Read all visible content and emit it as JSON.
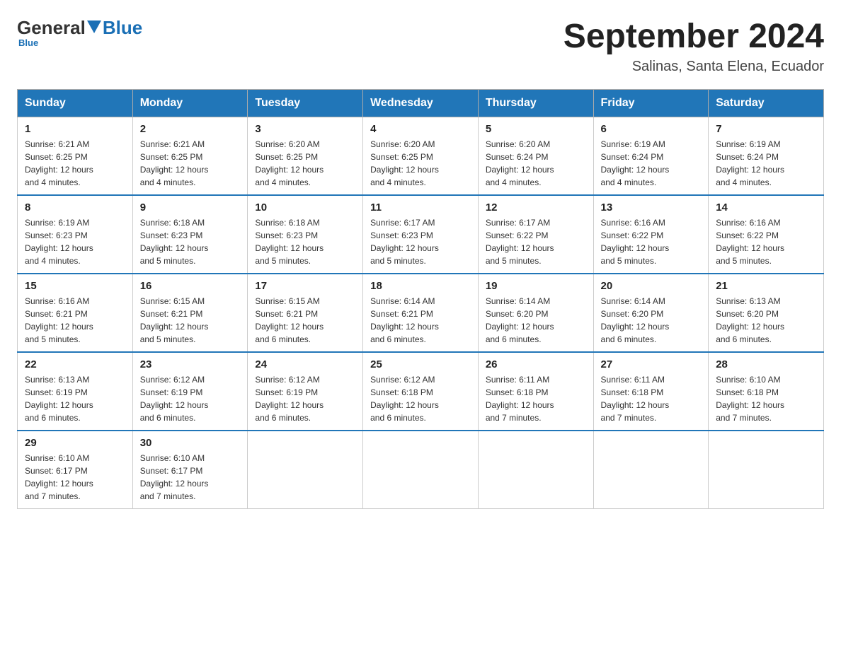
{
  "header": {
    "logo_general": "General",
    "logo_blue": "Blue",
    "month_title": "September 2024",
    "location": "Salinas, Santa Elena, Ecuador"
  },
  "days_of_week": [
    "Sunday",
    "Monday",
    "Tuesday",
    "Wednesday",
    "Thursday",
    "Friday",
    "Saturday"
  ],
  "weeks": [
    [
      {
        "day": "1",
        "sunrise": "6:21 AM",
        "sunset": "6:25 PM",
        "daylight": "12 hours and 4 minutes."
      },
      {
        "day": "2",
        "sunrise": "6:21 AM",
        "sunset": "6:25 PM",
        "daylight": "12 hours and 4 minutes."
      },
      {
        "day": "3",
        "sunrise": "6:20 AM",
        "sunset": "6:25 PM",
        "daylight": "12 hours and 4 minutes."
      },
      {
        "day": "4",
        "sunrise": "6:20 AM",
        "sunset": "6:25 PM",
        "daylight": "12 hours and 4 minutes."
      },
      {
        "day": "5",
        "sunrise": "6:20 AM",
        "sunset": "6:24 PM",
        "daylight": "12 hours and 4 minutes."
      },
      {
        "day": "6",
        "sunrise": "6:19 AM",
        "sunset": "6:24 PM",
        "daylight": "12 hours and 4 minutes."
      },
      {
        "day": "7",
        "sunrise": "6:19 AM",
        "sunset": "6:24 PM",
        "daylight": "12 hours and 4 minutes."
      }
    ],
    [
      {
        "day": "8",
        "sunrise": "6:19 AM",
        "sunset": "6:23 PM",
        "daylight": "12 hours and 4 minutes."
      },
      {
        "day": "9",
        "sunrise": "6:18 AM",
        "sunset": "6:23 PM",
        "daylight": "12 hours and 5 minutes."
      },
      {
        "day": "10",
        "sunrise": "6:18 AM",
        "sunset": "6:23 PM",
        "daylight": "12 hours and 5 minutes."
      },
      {
        "day": "11",
        "sunrise": "6:17 AM",
        "sunset": "6:23 PM",
        "daylight": "12 hours and 5 minutes."
      },
      {
        "day": "12",
        "sunrise": "6:17 AM",
        "sunset": "6:22 PM",
        "daylight": "12 hours and 5 minutes."
      },
      {
        "day": "13",
        "sunrise": "6:16 AM",
        "sunset": "6:22 PM",
        "daylight": "12 hours and 5 minutes."
      },
      {
        "day": "14",
        "sunrise": "6:16 AM",
        "sunset": "6:22 PM",
        "daylight": "12 hours and 5 minutes."
      }
    ],
    [
      {
        "day": "15",
        "sunrise": "6:16 AM",
        "sunset": "6:21 PM",
        "daylight": "12 hours and 5 minutes."
      },
      {
        "day": "16",
        "sunrise": "6:15 AM",
        "sunset": "6:21 PM",
        "daylight": "12 hours and 5 minutes."
      },
      {
        "day": "17",
        "sunrise": "6:15 AM",
        "sunset": "6:21 PM",
        "daylight": "12 hours and 6 minutes."
      },
      {
        "day": "18",
        "sunrise": "6:14 AM",
        "sunset": "6:21 PM",
        "daylight": "12 hours and 6 minutes."
      },
      {
        "day": "19",
        "sunrise": "6:14 AM",
        "sunset": "6:20 PM",
        "daylight": "12 hours and 6 minutes."
      },
      {
        "day": "20",
        "sunrise": "6:14 AM",
        "sunset": "6:20 PM",
        "daylight": "12 hours and 6 minutes."
      },
      {
        "day": "21",
        "sunrise": "6:13 AM",
        "sunset": "6:20 PM",
        "daylight": "12 hours and 6 minutes."
      }
    ],
    [
      {
        "day": "22",
        "sunrise": "6:13 AM",
        "sunset": "6:19 PM",
        "daylight": "12 hours and 6 minutes."
      },
      {
        "day": "23",
        "sunrise": "6:12 AM",
        "sunset": "6:19 PM",
        "daylight": "12 hours and 6 minutes."
      },
      {
        "day": "24",
        "sunrise": "6:12 AM",
        "sunset": "6:19 PM",
        "daylight": "12 hours and 6 minutes."
      },
      {
        "day": "25",
        "sunrise": "6:12 AM",
        "sunset": "6:18 PM",
        "daylight": "12 hours and 6 minutes."
      },
      {
        "day": "26",
        "sunrise": "6:11 AM",
        "sunset": "6:18 PM",
        "daylight": "12 hours and 7 minutes."
      },
      {
        "day": "27",
        "sunrise": "6:11 AM",
        "sunset": "6:18 PM",
        "daylight": "12 hours and 7 minutes."
      },
      {
        "day": "28",
        "sunrise": "6:10 AM",
        "sunset": "6:18 PM",
        "daylight": "12 hours and 7 minutes."
      }
    ],
    [
      {
        "day": "29",
        "sunrise": "6:10 AM",
        "sunset": "6:17 PM",
        "daylight": "12 hours and 7 minutes."
      },
      {
        "day": "30",
        "sunrise": "6:10 AM",
        "sunset": "6:17 PM",
        "daylight": "12 hours and 7 minutes."
      },
      null,
      null,
      null,
      null,
      null
    ]
  ],
  "sunrise_label": "Sunrise:",
  "sunset_label": "Sunset:",
  "daylight_label": "Daylight:"
}
